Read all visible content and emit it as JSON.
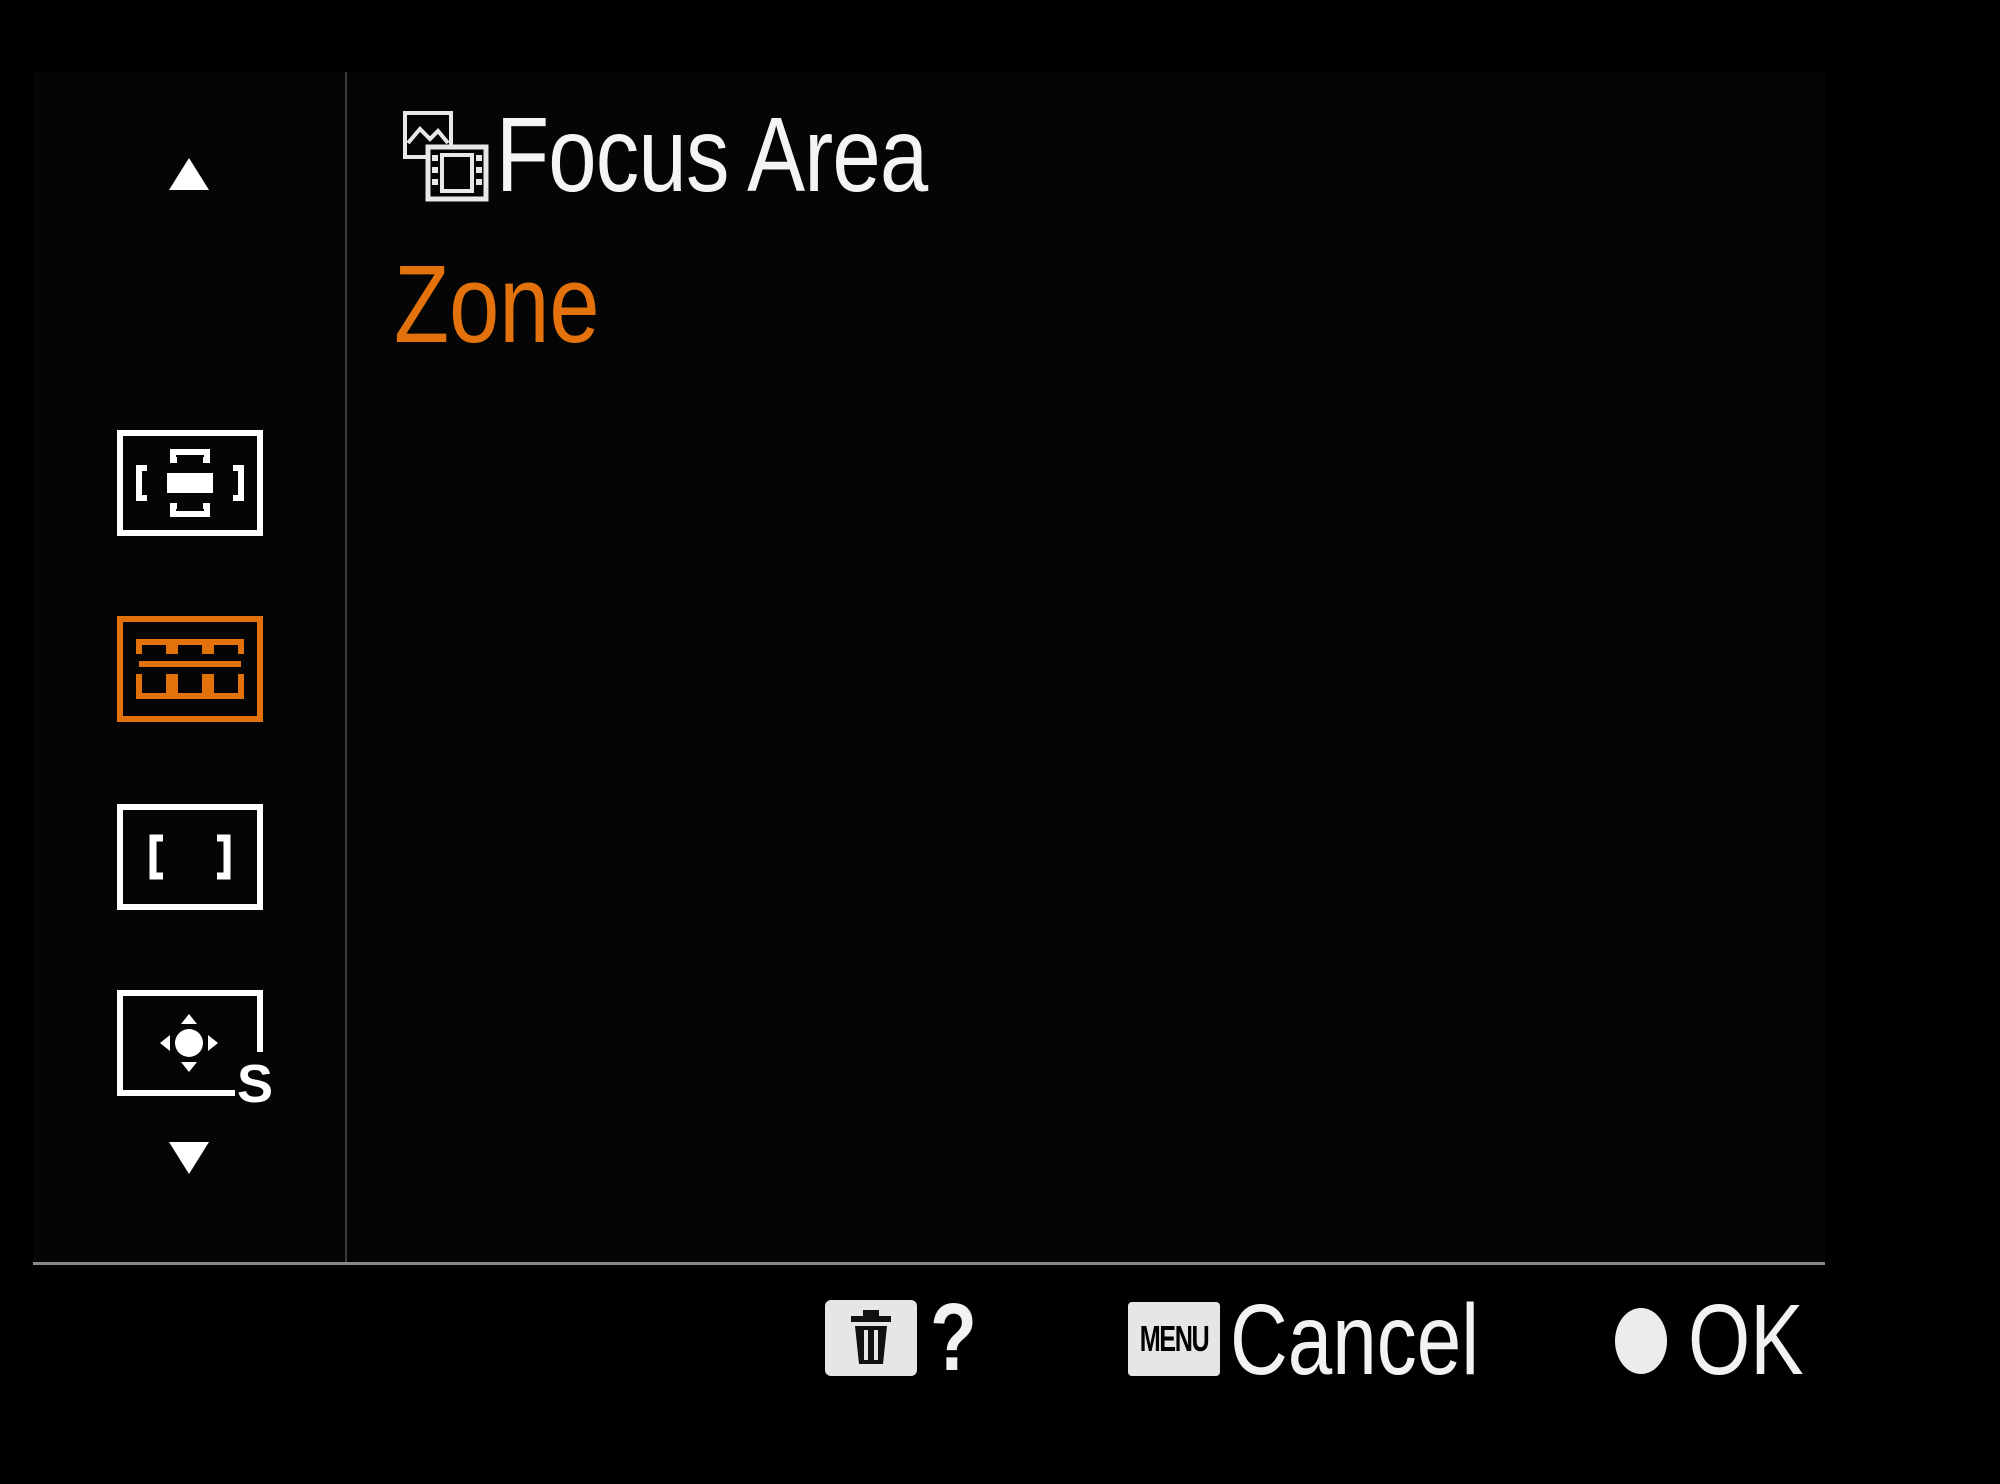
{
  "menu": {
    "title": "Focus Area",
    "title_icon": "still-movie-icon",
    "selected_value": "Zone",
    "accent_color": "#e4720c",
    "options": [
      {
        "icon": "wide-af-icon",
        "selected": false
      },
      {
        "icon": "zone-af-icon",
        "selected": true
      },
      {
        "icon": "center-af-icon",
        "selected": false
      },
      {
        "icon": "flexible-spot-s-af-icon",
        "selected": false
      }
    ]
  },
  "footer": {
    "help_label": "?",
    "menu_key_label": "MENU",
    "cancel_label": "Cancel",
    "ok_label": "OK"
  }
}
